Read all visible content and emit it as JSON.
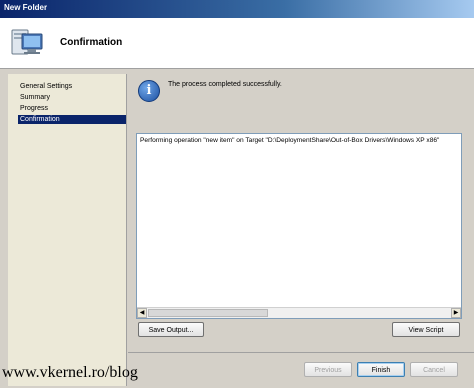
{
  "window": {
    "title": "New Folder"
  },
  "header": {
    "title": "Confirmation",
    "icon": "computer-icon"
  },
  "nav": {
    "items": [
      {
        "label": "General Settings",
        "active": false
      },
      {
        "label": "Summary",
        "active": false
      },
      {
        "label": "Progress",
        "active": false
      },
      {
        "label": "Confirmation",
        "active": true
      }
    ]
  },
  "main": {
    "info_icon": "info-icon",
    "message": "The process completed successfully.",
    "output_text": "Performing operation \"new item\" on Target \"D:\\DeploymentShare\\Out-of-Box Drivers\\Windows XP x86\"",
    "save_output_label": "Save Output...",
    "view_script_label": "View Script"
  },
  "footer": {
    "previous_label": "Previous",
    "finish_label": "Finish",
    "cancel_label": "Cancel"
  },
  "watermark": "www.vkernel.ro/blog",
  "colors": {
    "selection": "#0a246a",
    "titlebar": "#0a246a",
    "info": "#1c4fa0"
  }
}
